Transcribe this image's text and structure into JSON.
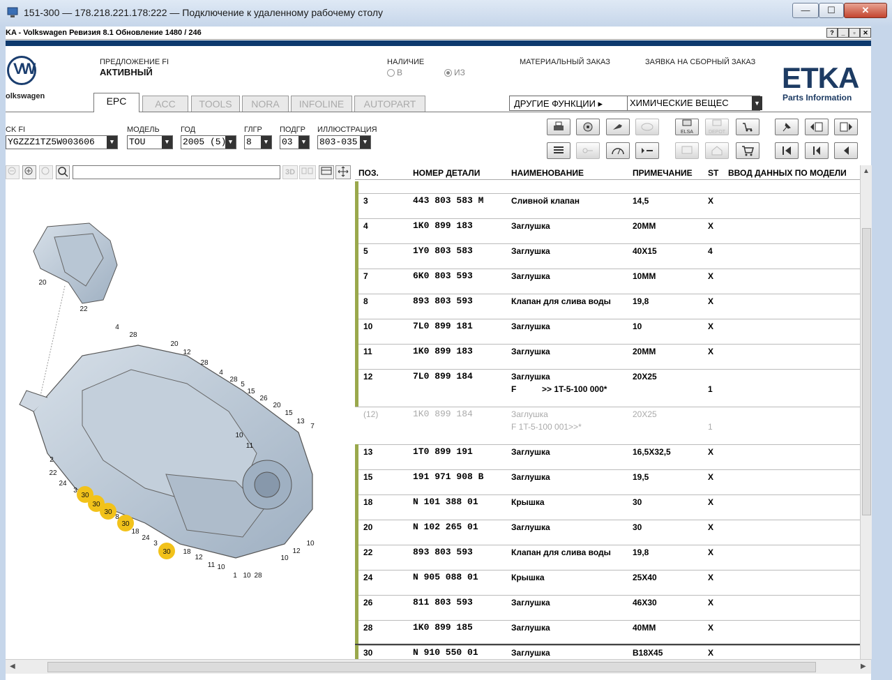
{
  "rdp": {
    "title": "151-300 — 178.218.221.178:222 — Подключение к удаленному рабочему столу",
    "minimize": "—",
    "maximize": "☐",
    "close": "✕"
  },
  "app": {
    "title": "KA - Volkswagen Ревизия 8.1 Обновление 1480 / 246",
    "mdi_help": "?",
    "mdi_min": "_",
    "mdi_restore": "▫",
    "mdi_close": "✕"
  },
  "header": {
    "brand_text": "olkswagen",
    "offer_label": "ПРЕДЛОЖЕНИЕ FI",
    "offer_value": "АКТИВНЫЙ",
    "availability_label": "НАЛИЧИЕ",
    "avail_opt1": "В",
    "avail_opt2": "ИЗ",
    "material_order": "МАТЕРИАЛЬНЫЙ ЗАКАЗ",
    "assembly_order": "ЗАЯВКА НА СБОРНЫЙ ЗАКАЗ",
    "etka": "ETKA",
    "etka_sub": "Parts Information"
  },
  "tabs": [
    "EPC",
    "ACC",
    "TOOLS",
    "NORA",
    "INFOLINE",
    "AUTOPART"
  ],
  "other_functions": {
    "label": "ДРУГИЕ ФУНКЦИИ",
    "value": "ХИМИЧЕСКИЕ ВЕЩЕС"
  },
  "selectors": {
    "vin_label": "CK FI",
    "vin_value": "YGZZZ1TZ5W003606",
    "model_label": "МОДЕЛЬ",
    "model_value": "TOU",
    "year_label": "ГОД",
    "year_value": "2005 (5)",
    "mg_label": "ГЛГР",
    "mg_value": "8",
    "sg_label": "ПОДГР",
    "sg_value": "03",
    "illu_label": "ИЛЛЮСТРАЦИЯ",
    "illu_value": "803-035"
  },
  "toolbar": {
    "elsa": "ELSA",
    "depot": "DEPOT"
  },
  "view_tools": {
    "btn_3d": "3D"
  },
  "table": {
    "headers": {
      "pos": "ПОЗ.",
      "part": "НОМЕР ДЕТАЛИ",
      "name": "НАИМЕНОВАНИЕ",
      "note": "ПРИМЕЧАНИЕ",
      "st": "ST",
      "model": "ВВОД ДАННЫХ ПО МОДЕЛИ"
    },
    "rows": [
      {
        "pos": "3",
        "part": "443 803 583 M",
        "name": "Сливной клапан",
        "note": "14,5",
        "st": "X"
      },
      {
        "pos": "4",
        "part": "1K0 899 183",
        "name": "Заглушка",
        "note": "20MM",
        "st": "X"
      },
      {
        "pos": "5",
        "part": "1Y0 803 583",
        "name": "Заглушка",
        "note": "40X15",
        "st": "4"
      },
      {
        "pos": "7",
        "part": "6K0 803 593",
        "name": "Заглушка",
        "note": "10MM",
        "st": "X"
      },
      {
        "pos": "8",
        "part": "893 803 593",
        "name": "Клапан для слива воды",
        "note": "19,8",
        "st": "X"
      },
      {
        "pos": "10",
        "part": "7L0 899 181",
        "name": "Заглушка",
        "note": "10",
        "st": "X"
      },
      {
        "pos": "11",
        "part": "1K0 899 183",
        "name": "Заглушка",
        "note": "20MM",
        "st": "X"
      },
      {
        "pos": "12",
        "part": "7L0 899 184",
        "name": "Заглушка",
        "name2": "F           >> 1T-5-100 000*",
        "note": "20X25",
        "st": "",
        "st2": "1"
      },
      {
        "pos": "(12)",
        "part": "1K0 899 184",
        "name": "Заглушка",
        "name2": "F 1T-5-100 001>>*",
        "note": "20X25",
        "st": "",
        "st2": "1"
      },
      {
        "pos": "13",
        "part": "1T0 899 191",
        "name": "Заглушка",
        "note": "16,5X32,5",
        "st": "X"
      },
      {
        "pos": "15",
        "part": "191 971 908 B",
        "name": "Заглушка",
        "note": "19,5",
        "st": "X"
      },
      {
        "pos": "18",
        "part": "N   101 388 01",
        "name": "Крышка",
        "note": "30",
        "st": "X"
      },
      {
        "pos": "20",
        "part": "N   102 265 01",
        "name": "Заглушка",
        "note": "30",
        "st": "X"
      },
      {
        "pos": "22",
        "part": "893 803 593",
        "name": "Клапан для слива воды",
        "note": "19,8",
        "st": "X"
      },
      {
        "pos": "24",
        "part": "N   905 088 01",
        "name": "Крышка",
        "note": "25X40",
        "st": "X"
      },
      {
        "pos": "26",
        "part": "811 803 593",
        "name": "Заглушка",
        "note": "46X30",
        "st": "X"
      },
      {
        "pos": "28",
        "part": "1K0 899 185",
        "name": "Заглушка",
        "note": "40MM",
        "st": "X"
      },
      {
        "pos": "30",
        "part": "N   910 550 01",
        "name": "Заглушка",
        "note": "B18X45",
        "st": "X"
      }
    ]
  },
  "callouts": {
    "top": [
      "20",
      "22"
    ],
    "main": [
      "4",
      "28",
      "20",
      "12",
      "28",
      "4",
      "28",
      "5",
      "15",
      "26",
      "20",
      "15",
      "13",
      "7",
      "10",
      "11",
      "2",
      "22",
      "24",
      "3",
      "30",
      "30",
      "30",
      "8",
      "30",
      "18",
      "24",
      "3",
      "30",
      "18",
      "12",
      "11",
      "10",
      "1",
      "10",
      "28",
      "10",
      "12",
      "10"
    ],
    "highlight_color": "#f2c21a"
  }
}
